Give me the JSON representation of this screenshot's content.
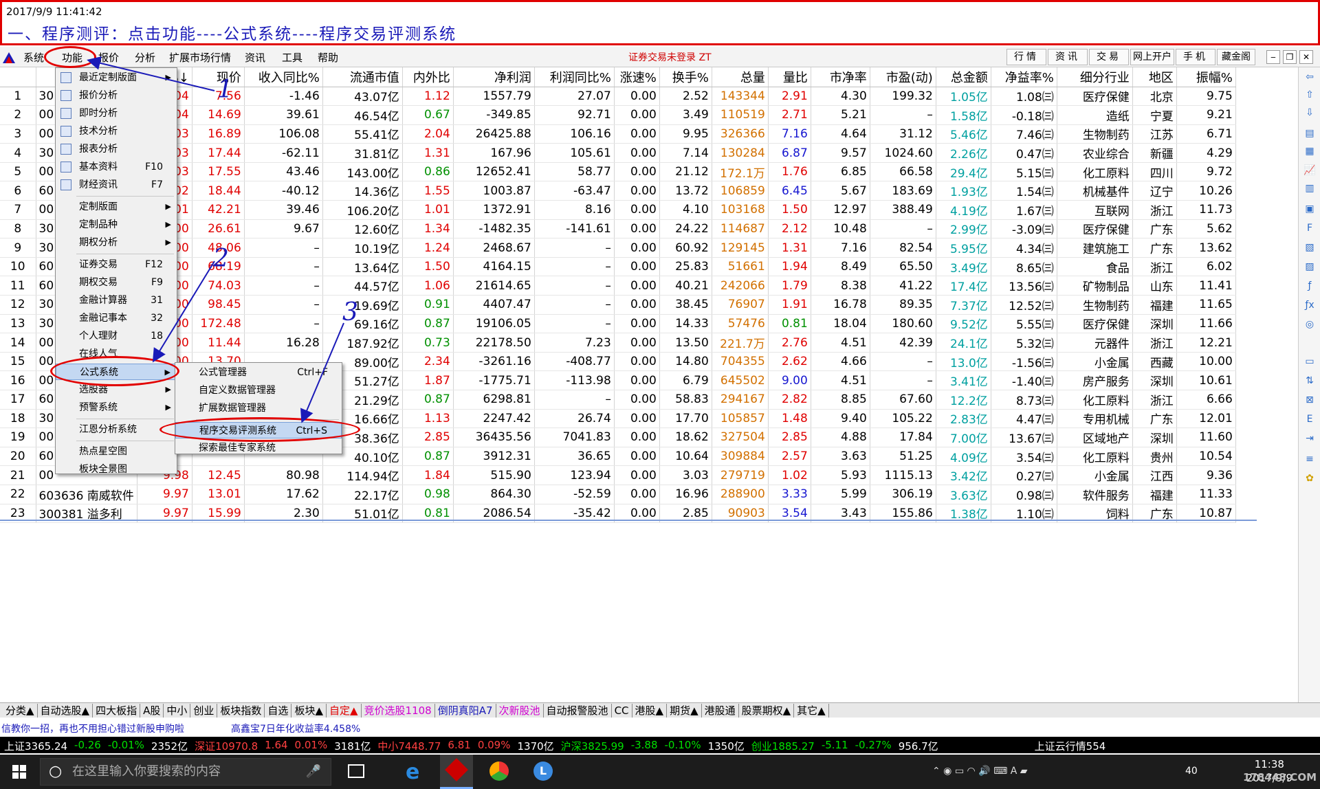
{
  "banner": {
    "timestamp": "2017/9/9 11:41:42",
    "title": "一、程序测评：点击功能----公式系统----程序交易评测系统"
  },
  "menubar": {
    "items": [
      "系统",
      "功能",
      "报价",
      "分析",
      "扩展市场行情",
      "资讯",
      "工具",
      "帮助"
    ],
    "status": "证券交易未登录  ZT",
    "right_buttons": [
      "行情",
      "资讯",
      "交易",
      "网上开户",
      "手机",
      "藏金阁"
    ]
  },
  "table": {
    "headers": [
      "",
      "代",
      "幅%↓",
      "现价",
      "收入同比%",
      "流通市值",
      "内外比",
      "净利润",
      "利润同比%",
      "涨速%",
      "换手%",
      "总量",
      "量比",
      "市净率",
      "市盈(动)",
      "总金额",
      "净益率%",
      "细分行业",
      "地区",
      "振幅%"
    ],
    "rows": [
      [
        "1",
        "30",
        "",
        "0.04",
        "7.56",
        "-1.46",
        "43.07亿",
        "1.12",
        "1557.79",
        "27.07",
        "0.00",
        "2.52",
        "143344",
        "2.91",
        "4.30",
        "199.32",
        "1.05亿",
        "1.08㈢",
        "医疗保健",
        "北京",
        "9.75"
      ],
      [
        "2",
        "00",
        "",
        "0.04",
        "14.69",
        "39.61",
        "46.54亿",
        "0.67",
        "-349.85",
        "92.71",
        "0.00",
        "3.49",
        "110519",
        "2.71",
        "5.21",
        "–",
        "1.58亿",
        "-0.18㈢",
        "造纸",
        "宁夏",
        "9.21"
      ],
      [
        "3",
        "00",
        "",
        "0.03",
        "16.89",
        "106.08",
        "55.41亿",
        "2.04",
        "26425.88",
        "106.16",
        "0.00",
        "9.95",
        "326366",
        "7.16",
        "4.64",
        "31.12",
        "5.46亿",
        "7.46㈢",
        "生物制药",
        "江苏",
        "6.71"
      ],
      [
        "4",
        "30",
        "",
        "0.03",
        "17.44",
        "-62.11",
        "31.81亿",
        "1.31",
        "167.96",
        "105.61",
        "0.00",
        "7.14",
        "130284",
        "6.87",
        "9.57",
        "1024.60",
        "2.26亿",
        "0.47㈢",
        "农业综合",
        "新疆",
        "4.29"
      ],
      [
        "5",
        "00",
        "",
        "0.03",
        "17.55",
        "43.46",
        "143.00亿",
        "0.86",
        "12652.41",
        "58.77",
        "0.00",
        "21.12",
        "172.1万",
        "1.76",
        "6.85",
        "66.58",
        "29.4亿",
        "5.15㈢",
        "化工原料",
        "四川",
        "9.72"
      ],
      [
        "6",
        "60",
        "",
        "0.02",
        "18.44",
        "-40.12",
        "14.36亿",
        "1.55",
        "1003.87",
        "-63.47",
        "0.00",
        "13.72",
        "106859",
        "6.45",
        "5.67",
        "183.69",
        "1.93亿",
        "1.54㈢",
        "机械基件",
        "辽宁",
        "10.26"
      ],
      [
        "7",
        "00",
        "",
        "0.01",
        "42.21",
        "39.46",
        "106.20亿",
        "1.01",
        "1372.91",
        "8.16",
        "0.00",
        "4.10",
        "103168",
        "1.50",
        "12.97",
        "388.49",
        "4.19亿",
        "1.67㈢",
        "互联网",
        "浙江",
        "11.73"
      ],
      [
        "8",
        "30",
        "",
        "0.00",
        "26.61",
        "9.67",
        "12.60亿",
        "1.34",
        "-1482.35",
        "-141.61",
        "0.00",
        "24.22",
        "114687",
        "2.12",
        "10.48",
        "–",
        "2.99亿",
        "-3.09㈢",
        "医疗保健",
        "广东",
        "5.62"
      ],
      [
        "9",
        "30",
        "",
        "0.00",
        "48.06",
        "–",
        "10.19亿",
        "1.24",
        "2468.67",
        "–",
        "0.00",
        "60.92",
        "129145",
        "1.31",
        "7.16",
        "82.54",
        "5.95亿",
        "4.34㈢",
        "建筑施工",
        "广东",
        "13.62"
      ],
      [
        "10",
        "60",
        "",
        "0.00",
        "68.19",
        "–",
        "13.64亿",
        "1.50",
        "4164.15",
        "–",
        "0.00",
        "25.83",
        "51661",
        "1.94",
        "8.49",
        "65.50",
        "3.49亿",
        "8.65㈢",
        "食品",
        "浙江",
        "6.02"
      ],
      [
        "11",
        "60",
        "",
        "0.00",
        "74.03",
        "–",
        "44.57亿",
        "1.06",
        "21614.65",
        "–",
        "0.00",
        "40.21",
        "242066",
        "1.79",
        "8.38",
        "41.22",
        "17.4亿",
        "13.56㈢",
        "矿物制品",
        "山东",
        "11.41"
      ],
      [
        "12",
        "30",
        "",
        "0.00",
        "98.45",
        "–",
        "19.69亿",
        "0.91",
        "4407.47",
        "–",
        "0.00",
        "38.45",
        "76907",
        "1.91",
        "16.78",
        "89.35",
        "7.37亿",
        "12.52㈢",
        "生物制药",
        "福建",
        "11.65"
      ],
      [
        "13",
        "30",
        "",
        "0.00",
        "172.48",
        "–",
        "69.16亿",
        "0.87",
        "19106.05",
        "–",
        "0.00",
        "14.33",
        "57476",
        "0.81",
        "18.04",
        "180.60",
        "9.52亿",
        "5.55㈢",
        "医疗保健",
        "深圳",
        "11.66"
      ],
      [
        "14",
        "00",
        "",
        "0.00",
        "11.44",
        "16.28",
        "187.92亿",
        "0.73",
        "22178.50",
        "7.23",
        "0.00",
        "13.50",
        "221.7万",
        "2.76",
        "4.51",
        "42.39",
        "24.1亿",
        "5.32㈢",
        "元器件",
        "浙江",
        "12.21"
      ],
      [
        "15",
        "00",
        "",
        "0.00",
        "13.70",
        "",
        "89.00亿",
        "2.34",
        "-3261.16",
        "-408.77",
        "0.00",
        "14.80",
        "704355",
        "2.62",
        "4.66",
        "–",
        "13.0亿",
        "-1.56㈢",
        "小金属",
        "西藏",
        "10.00"
      ],
      [
        "16",
        "00",
        "",
        "",
        "",
        "",
        "51.27亿",
        "1.87",
        "-1775.71",
        "-113.98",
        "0.00",
        "6.79",
        "645502",
        "9.00",
        "4.51",
        "–",
        "3.41亿",
        "-1.40㈢",
        "房产服务",
        "深圳",
        "10.61"
      ],
      [
        "17",
        "60",
        "",
        "",
        "",
        "",
        "21.29亿",
        "0.87",
        "6298.81",
        "–",
        "0.00",
        "58.83",
        "294167",
        "2.82",
        "8.85",
        "67.60",
        "12.2亿",
        "8.73㈢",
        "化工原料",
        "浙江",
        "6.66"
      ],
      [
        "18",
        "30",
        "",
        "",
        "",
        "",
        "16.66亿",
        "1.13",
        "2247.42",
        "26.74",
        "0.00",
        "17.70",
        "105857",
        "1.48",
        "9.40",
        "105.22",
        "2.83亿",
        "4.47㈢",
        "专用机械",
        "广东",
        "12.01"
      ],
      [
        "19",
        "00",
        "",
        "",
        "",
        "",
        "38.36亿",
        "2.85",
        "36435.56",
        "7041.83",
        "0.00",
        "18.62",
        "327504",
        "2.85",
        "4.88",
        "17.84",
        "7.00亿",
        "13.67㈢",
        "区域地产",
        "深圳",
        "11.60"
      ],
      [
        "20",
        "60",
        "",
        "",
        "",
        "",
        "40.10亿",
        "0.87",
        "3912.31",
        "36.65",
        "0.00",
        "10.64",
        "309884",
        "2.57",
        "3.63",
        "51.25",
        "4.09亿",
        "3.54㈢",
        "化工原料",
        "贵州",
        "10.54"
      ],
      [
        "21",
        "00",
        "",
        "9.98",
        "12.45",
        "80.98",
        "114.94亿",
        "1.84",
        "515.90",
        "123.94",
        "0.00",
        "3.03",
        "279719",
        "1.02",
        "5.93",
        "1115.13",
        "3.42亿",
        "0.27㈢",
        "小金属",
        "江西",
        "9.36"
      ],
      [
        "22",
        "603636",
        "南威软件",
        "9.97",
        "13.01",
        "17.62",
        "22.17亿",
        "0.98",
        "864.30",
        "-52.59",
        "0.00",
        "16.96",
        "288900",
        "3.33",
        "5.99",
        "306.19",
        "3.63亿",
        "0.98㈢",
        "软件服务",
        "福建",
        "11.33"
      ],
      [
        "23",
        "300381",
        "溢多利",
        "9.97",
        "15.99",
        "2.30",
        "51.01亿",
        "0.81",
        "2086.54",
        "-35.42",
        "0.00",
        "2.85",
        "90903",
        "3.54",
        "3.43",
        "155.86",
        "1.38亿",
        "1.10㈢",
        "饲料",
        "广东",
        "10.87"
      ]
    ]
  },
  "menu_main": [
    {
      "label": "最近定制版面",
      "icon": "layout-icon",
      "arrow": true
    },
    {
      "label": "报价分析",
      "icon": "grid-icon"
    },
    {
      "label": "即时分析",
      "icon": "line-icon"
    },
    {
      "label": "技术分析",
      "icon": "candle-icon"
    },
    {
      "label": "报表分析",
      "icon": "report-icon"
    },
    {
      "label": "基本资料",
      "shortcut": "F10",
      "icon": "f10-icon"
    },
    {
      "label": "财经资讯",
      "shortcut": "F7",
      "icon": "news-icon"
    },
    {
      "sep": true
    },
    {
      "label": "定制版面",
      "arrow": true
    },
    {
      "label": "定制品种",
      "arrow": true
    },
    {
      "label": "期权分析",
      "arrow": true
    },
    {
      "sep": true
    },
    {
      "label": "证券交易",
      "shortcut": "F12"
    },
    {
      "label": "期权交易",
      "shortcut": "F9"
    },
    {
      "label": "金融计算器",
      "shortcut": "31"
    },
    {
      "label": "金融记事本",
      "shortcut": "32"
    },
    {
      "label": "个人理财",
      "shortcut": "18"
    },
    {
      "label": "在线人气"
    },
    {
      "label": "公式系统",
      "arrow": true,
      "highlight": true
    },
    {
      "label": "选股器",
      "arrow": true
    },
    {
      "label": "预警系统",
      "arrow": true
    },
    {
      "sep": true
    },
    {
      "label": "江恩分析系统"
    },
    {
      "sep": true
    },
    {
      "label": "热点星空图"
    },
    {
      "label": "板块全景图"
    }
  ],
  "menu_sub": [
    {
      "label": "公式管理器",
      "shortcut": "Ctrl+F"
    },
    {
      "label": "自定义数据管理器"
    },
    {
      "label": "扩展数据管理器"
    },
    {
      "sep": true
    },
    {
      "label": "程序交易评测系统",
      "shortcut": "Ctrl+S",
      "highlight": true
    },
    {
      "label": "探索最佳专家系统"
    }
  ],
  "annotations": [
    "1",
    "2",
    "3"
  ],
  "tabs": [
    {
      "label": "分类▲"
    },
    {
      "label": "自动选股▲"
    },
    {
      "label": "四大板指"
    },
    {
      "label": "A股"
    },
    {
      "label": "中小"
    },
    {
      "label": "创业"
    },
    {
      "label": "板块指数"
    },
    {
      "label": "自选"
    },
    {
      "label": "板块▲"
    },
    {
      "label": "自定▲",
      "color": "red"
    },
    {
      "label": "竞价选股1108",
      "color": "pink"
    },
    {
      "label": "倒阴真阳A7",
      "color": "blue"
    },
    {
      "label": "次新股池",
      "color": "pink"
    },
    {
      "label": "自动报警股池"
    },
    {
      "label": "CC"
    },
    {
      "label": "港股▲"
    },
    {
      "label": "期货▲"
    },
    {
      "label": "港股通"
    },
    {
      "label": "股票期权▲"
    },
    {
      "label": "其它▲"
    }
  ],
  "ticker1": {
    "left": "信教你一招，再也不用担心错过新股申购啦",
    "right": "高鑫宝7日年化收益率4.458%"
  },
  "ticker2": [
    {
      "text": "上证3365.24",
      "color": "#ffffff"
    },
    {
      "text": "-0.26",
      "color": "#00e000"
    },
    {
      "text": "-0.01%",
      "color": "#00e000"
    },
    {
      "text": "2352亿",
      "color": "#ffffff"
    },
    {
      "text": "深证10970.8",
      "color": "#ff4040"
    },
    {
      "text": "1.64",
      "color": "#ff4040"
    },
    {
      "text": "0.01%",
      "color": "#ff4040"
    },
    {
      "text": "3181亿",
      "color": "#ffffff"
    },
    {
      "text": "中小7448.77",
      "color": "#ff4040"
    },
    {
      "text": "6.81",
      "color": "#ff4040"
    },
    {
      "text": "0.09%",
      "color": "#ff4040"
    },
    {
      "text": "1370亿",
      "color": "#ffffff"
    },
    {
      "text": "沪深3825.99",
      "color": "#00e000"
    },
    {
      "text": "-3.88",
      "color": "#00e000"
    },
    {
      "text": "-0.10%",
      "color": "#00e000"
    },
    {
      "text": "1350亿",
      "color": "#ffffff"
    },
    {
      "text": "创业1885.27",
      "color": "#00e000"
    },
    {
      "text": "-5.11",
      "color": "#00e000"
    },
    {
      "text": "-0.27%",
      "color": "#00e000"
    },
    {
      "text": "956.7亿",
      "color": "#ffffff"
    },
    {
      "text": "上证云行情554",
      "color": "#ffffff"
    }
  ],
  "taskbar": {
    "search_placeholder": "在这里输入你要搜索的内容",
    "time": "11:38",
    "date": "2017/9/9",
    "watermark": "178448.COM",
    "volume": "40"
  }
}
